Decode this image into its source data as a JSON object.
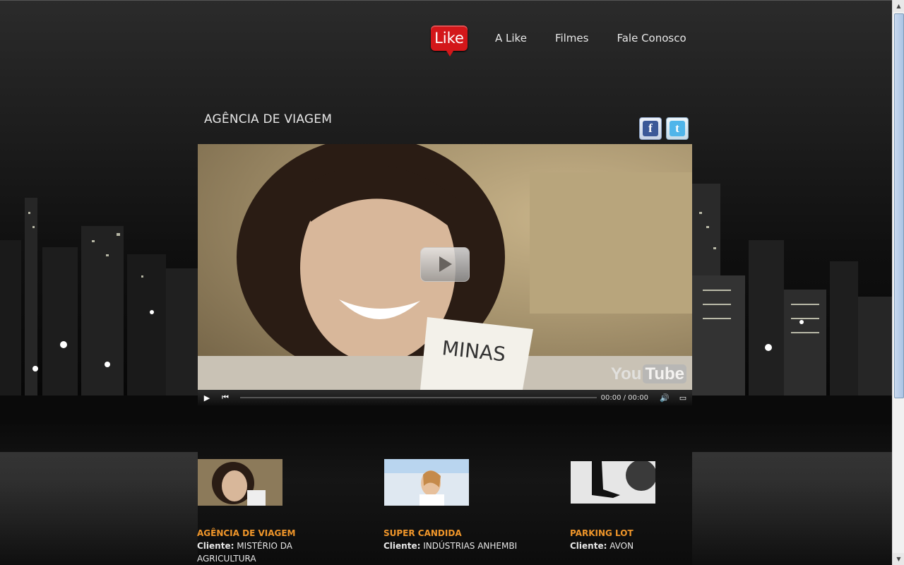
{
  "nav": {
    "logo": "Like",
    "items": [
      "A Like",
      "Filmes",
      "Fale Conosco"
    ]
  },
  "main": {
    "title": "AGÊNCIA DE VIAGEM"
  },
  "social": {
    "facebook": "f",
    "twitter": "t"
  },
  "video": {
    "sign_line1": "MINAS",
    "youtube_you": "You",
    "youtube_tube": "Tube",
    "time": "00:00 / 00:00"
  },
  "films": [
    {
      "title": "AGÊNCIA DE VIAGEM",
      "client_label": "Cliente:",
      "client": "MISTÉRIO DA AGRICULTURA"
    },
    {
      "title": "SUPER CANDIDA",
      "client_label": "Cliente:",
      "client": "INDÚSTRIAS ANHEMBI"
    },
    {
      "title": "PARKING LOT",
      "client_label": "Cliente:",
      "client": "AVON"
    }
  ]
}
